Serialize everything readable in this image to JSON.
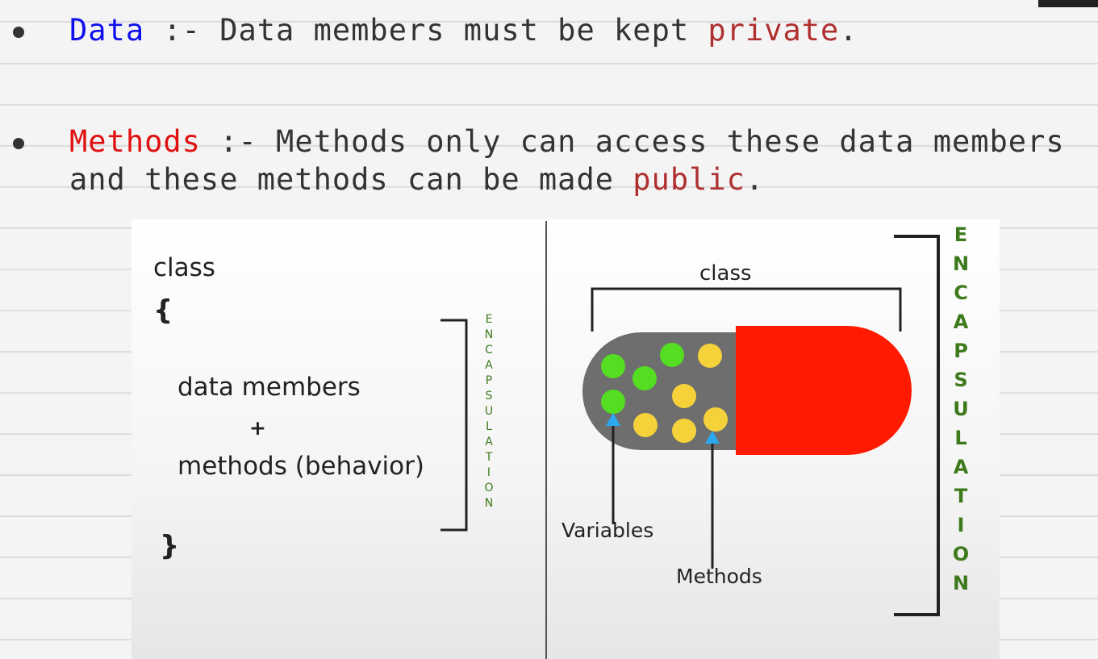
{
  "bullets": [
    {
      "term": "Data",
      "separator": " :- ",
      "text": "Data members must be kept ",
      "highlight": "private",
      "end": "."
    },
    {
      "term": "Methods",
      "separator": " :- ",
      "text": "Methods only can access these data members",
      "line2_text": "and these methods can be made ",
      "highlight": "public",
      "end": "."
    }
  ],
  "figure": {
    "left": {
      "keyword": "class",
      "open_brace": "{",
      "line1": "data members",
      "plus": "+",
      "line2": "methods (behavior)",
      "close_brace": "}",
      "side_label": [
        "E",
        "N",
        "C",
        "A",
        "P",
        "S",
        "U",
        "L",
        "A",
        "T",
        "I",
        "O",
        "N"
      ]
    },
    "right": {
      "class_label": "class",
      "variables_label": "Variables",
      "methods_label": "Methods",
      "side_label": [
        "E",
        "N",
        "C",
        "A",
        "P",
        "S",
        "U",
        "L",
        "A",
        "T",
        "I",
        "O",
        "N"
      ]
    },
    "colors": {
      "capsule_gray": "#6e6e6e",
      "capsule_red": "#ff1a00",
      "variable_dot": "#55dd22",
      "method_dot": "#f5d23a",
      "arrow": "#2aa8f0",
      "encapsulation_text": "#3d7a1c"
    }
  }
}
